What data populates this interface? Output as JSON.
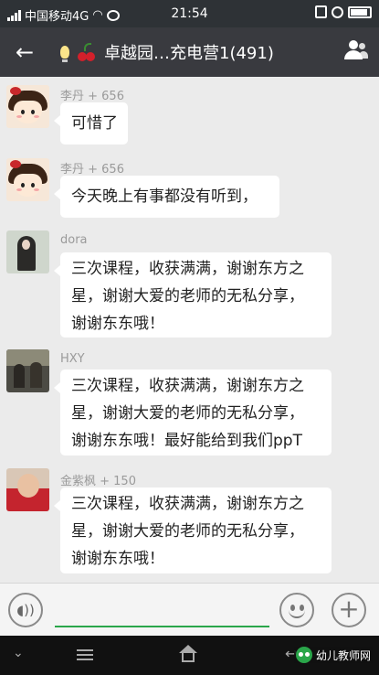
{
  "status_bar": {
    "carrier": "中国移动4G",
    "time": "21:54"
  },
  "header": {
    "title": "卓越园…充电营1(491)",
    "back_icon": "arrow-left-icon",
    "group_icon": "group-members-icon"
  },
  "messages": [
    {
      "sender": "李丹 + 656",
      "avatar": "cartoon-girl-avatar",
      "lines": [
        "可惜了"
      ]
    },
    {
      "sender": "李丹 + 656",
      "avatar": "cartoon-girl-avatar",
      "lines": [
        "今天晚上有事都没有听到，"
      ]
    },
    {
      "sender": "dora",
      "avatar": "photo-avatar",
      "lines": [
        "三次课程，收获满满，谢谢东方之",
        "星，谢谢大爱的老师的无私分享，",
        "谢谢东东哦！"
      ]
    },
    {
      "sender": "HXY",
      "avatar": "photo-avatar",
      "lines": [
        "三次课程，收获满满，谢谢东方之",
        "星，谢谢大爱的老师的无私分享，",
        "谢谢东东哦！最好能给到我们ppT"
      ]
    },
    {
      "sender": "金紫枫 + 150",
      "avatar": "baby-photo-avatar",
      "lines": [
        "三次课程，收获满满，谢谢东方之",
        "星，谢谢大爱的老师的无私分享，",
        "谢谢东东哦！"
      ]
    }
  ],
  "input_bar": {
    "voice_icon": "voice-icon",
    "emoji_icon": "emoji-icon",
    "plus_icon": "plus-icon",
    "placeholder": ""
  },
  "nav_bar": {
    "watermark": "幼儿教师网"
  },
  "colors": {
    "title_bg": "#393a3f",
    "chat_bg": "#ebebeb",
    "bubble": "#ffffff",
    "input_accent": "#2aa64a"
  }
}
